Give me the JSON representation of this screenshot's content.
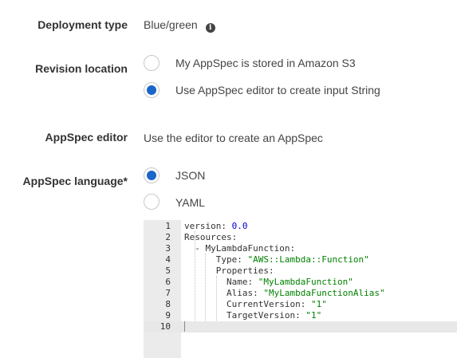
{
  "deployment_type": {
    "label": "Deployment type",
    "value": "Blue/green",
    "icon": "info-icon"
  },
  "revision_location": {
    "label": "Revision location",
    "options": [
      {
        "label": "My AppSpec is stored in Amazon S3",
        "checked": false
      },
      {
        "label": "Use AppSpec editor to create input String",
        "checked": true
      }
    ]
  },
  "appspec_editor": {
    "label": "AppSpec editor",
    "description": "Use the editor to create an AppSpec"
  },
  "appspec_language": {
    "label": "AppSpec language*",
    "options": [
      {
        "label": "JSON",
        "checked": true
      },
      {
        "label": "YAML",
        "checked": false
      }
    ]
  },
  "code_editor": {
    "accent_color": "#1a66c9",
    "active_line": 10,
    "lines": [
      {
        "num": "1",
        "key": "version: ",
        "num_val": "0.0"
      },
      {
        "num": "2",
        "key": "Resources:"
      },
      {
        "num": "3",
        "key": "  - MyLambdaFunction:"
      },
      {
        "num": "4",
        "key": "      Type: ",
        "str_val": "\"AWS::Lambda::Function\""
      },
      {
        "num": "5",
        "key": "      Properties:"
      },
      {
        "num": "6",
        "key": "        Name: ",
        "str_val": "\"MyLambdaFunction\""
      },
      {
        "num": "7",
        "key": "        Alias: ",
        "str_val": "\"MyLambdaFunctionAlias\""
      },
      {
        "num": "8",
        "key": "        CurrentVersion: ",
        "str_val": "\"1\""
      },
      {
        "num": "9",
        "key": "        TargetVersion: ",
        "str_val": "\"1\""
      },
      {
        "num": "10",
        "key": ""
      }
    ]
  }
}
